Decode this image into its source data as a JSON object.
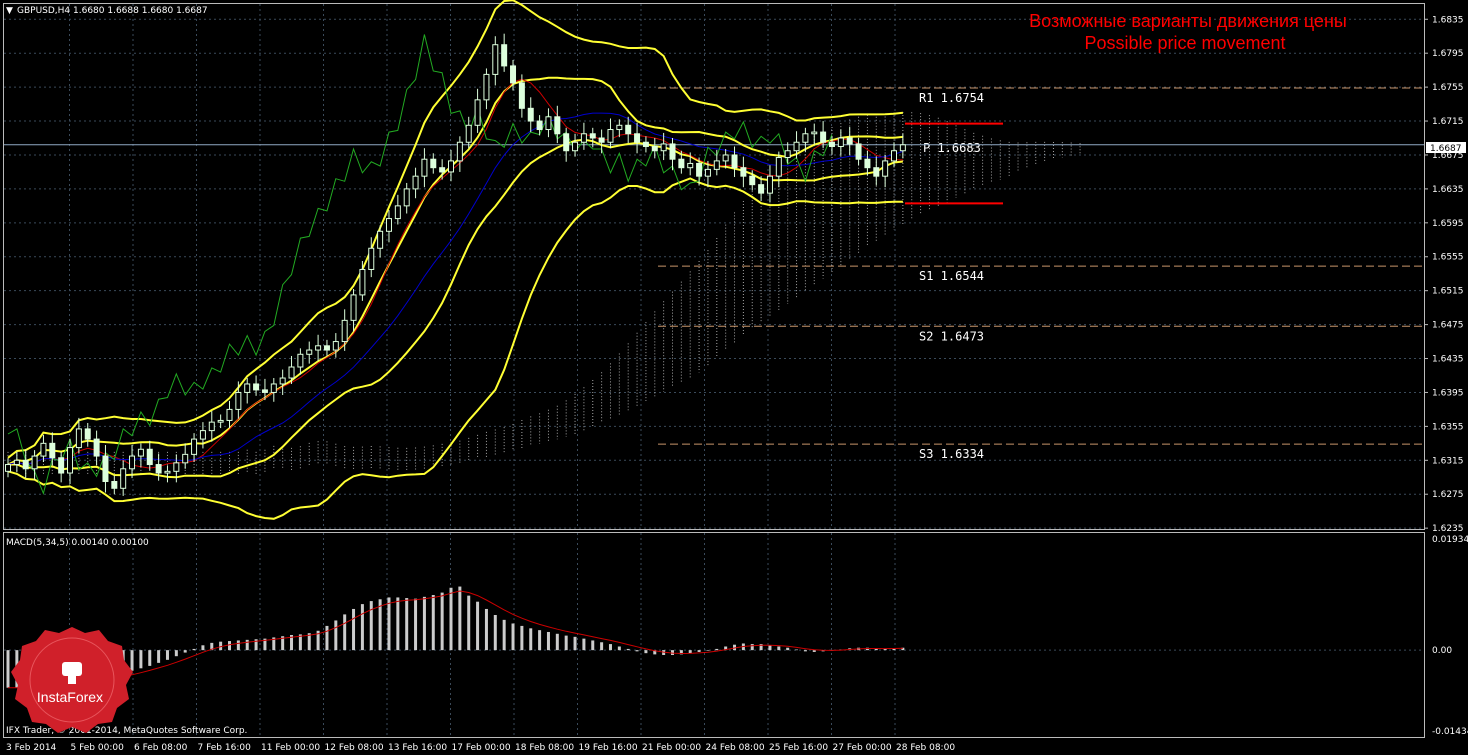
{
  "header": {
    "symbol_info": "GBPUSD,H4  1.6680 1.6688 1.6680 1.6687",
    "macd_info": "MACD(5,34,5) 0.00140 0.00100",
    "copyright": "IFX Trader, © 2001-2014, MetaQuotes Software Corp."
  },
  "annotation": {
    "line_ru": "Возможные варианты движения цены",
    "line_en": "Possible price movement"
  },
  "logo": {
    "text": "InstaForex"
  },
  "current_price": "1.6687",
  "colors": {
    "grid": "#3a4a5a",
    "price_line": "#8fa9c4",
    "bollinger": "#ffff33",
    "fast_ma": "#cc0000",
    "slow_ma": "#0000cc",
    "chikou": "#22aa22",
    "candle": "#ddffdd",
    "macd_hist": "#cccccc",
    "macd_signal": "#cc0000",
    "pivot_line": "#ff0000",
    "level_dash": "#c8956a",
    "cloud_a": "#d08a5a",
    "cloud_b": "#dddddd",
    "title_red": "#ff0000"
  },
  "chart_data": {
    "type": "candlestick",
    "price_range": [
      1.6234,
      1.6853
    ],
    "macd_range": [
      -0.01434,
      0.01934
    ],
    "price_ticks": [
      "1.6835",
      "1.6795",
      "1.6755",
      "1.6715",
      "1.6675",
      "1.6635",
      "1.6595",
      "1.6555",
      "1.6515",
      "1.6475",
      "1.6435",
      "1.6395",
      "1.6355",
      "1.6315",
      "1.6275",
      "1.6235"
    ],
    "macd_ticks": [
      "0.01934",
      "0.00",
      "-0.01434"
    ],
    "time_labels": [
      "3 Feb 2014",
      "5 Feb 00:00",
      "6 Feb 08:00",
      "7 Feb 16:00",
      "11 Feb 00:00",
      "12 Feb 08:00",
      "13 Feb 16:00",
      "17 Feb 00:00",
      "18 Feb 08:00",
      "19 Feb 16:00",
      "21 Feb 00:00",
      "24 Feb 08:00",
      "25 Feb 16:00",
      "27 Feb 00:00",
      "28 Feb 08:00"
    ],
    "levels": [
      {
        "label": "R1  1.6754",
        "value": 1.6754
      },
      {
        "label": "P  1.6683",
        "value": 1.6683
      },
      {
        "label": "S1  1.6544",
        "value": 1.6544
      },
      {
        "label": "S2  1.6473",
        "value": 1.6473
      },
      {
        "label": "S3  1.6334",
        "value": 1.6334
      }
    ],
    "projection": {
      "high": 1.6712,
      "low": 1.6618
    },
    "closes": [
      1.631,
      1.6315,
      1.6305,
      1.632,
      1.6335,
      1.6318,
      1.63,
      1.633,
      1.6352,
      1.634,
      1.632,
      1.629,
      1.6282,
      1.6305,
      1.632,
      1.6328,
      1.631,
      1.63,
      1.6302,
      1.6312,
      1.6322,
      1.634,
      1.635,
      1.636,
      1.6362,
      1.6375,
      1.6395,
      1.6405,
      1.6398,
      1.6395,
      1.6405,
      1.6412,
      1.6425,
      1.644,
      1.6445,
      1.645,
      1.6445,
      1.6455,
      1.648,
      1.651,
      1.654,
      1.6565,
      1.6585,
      1.66,
      1.6615,
      1.6635,
      1.665,
      1.667,
      1.666,
      1.6655,
      1.6668,
      1.669,
      1.671,
      1.674,
      1.677,
      1.6805,
      1.678,
      1.676,
      1.673,
      1.6715,
      1.6705,
      1.672,
      1.67,
      1.668,
      1.669,
      1.67,
      1.6695,
      1.669,
      1.6705,
      1.671,
      1.67,
      1.669,
      1.6685,
      1.668,
      1.6688,
      1.667,
      1.666,
      1.6665,
      1.665,
      1.6658,
      1.6668,
      1.6675,
      1.666,
      1.665,
      1.664,
      1.663,
      1.665,
      1.6672,
      1.668,
      1.669,
      1.67,
      1.6702,
      1.669,
      1.6685,
      1.6695,
      1.6688,
      1.667,
      1.666,
      1.665,
      1.6668,
      1.668,
      1.6687
    ],
    "macd_hist": [
      -0.0062,
      -0.0062,
      -0.0061,
      -0.006,
      -0.0059,
      -0.0058,
      -0.0056,
      -0.0055,
      -0.0053,
      -0.005,
      -0.0048,
      -0.0045,
      -0.0042,
      -0.0038,
      -0.0034,
      -0.003,
      -0.0026,
      -0.0021,
      -0.0016,
      -0.001,
      -0.0004,
      0.0002,
      0.0008,
      0.0012,
      0.0014,
      0.0015,
      0.0016,
      0.0017,
      0.0018,
      0.0019,
      0.0021,
      0.0023,
      0.0025,
      0.0026,
      0.0028,
      0.0032,
      0.004,
      0.0049,
      0.0059,
      0.0068,
      0.0076,
      0.0081,
      0.0084,
      0.0087,
      0.0087,
      0.0086,
      0.0085,
      0.0088,
      0.0091,
      0.0095,
      0.0103,
      0.0105,
      0.009,
      0.008,
      0.0068,
      0.0058,
      0.005,
      0.0044,
      0.004,
      0.0036,
      0.0033,
      0.003,
      0.0027,
      0.0024,
      0.0022,
      0.0019,
      0.0016,
      0.0013,
      0.001,
      0.0006,
      0.0002,
      -0.0002,
      -0.0005,
      -0.0007,
      -0.0008,
      -0.0008,
      -0.0007,
      -0.0005,
      -0.0003,
      -0.0001,
      0.0002,
      0.0006,
      0.0009,
      0.0011,
      0.001,
      0.001,
      0.0008,
      0.0006,
      0.0004,
      0.0001,
      -0.0002,
      -0.0003,
      -0.0002,
      -0.0001,
      0.0001,
      0.0003,
      0.0004,
      0.0004,
      0.0003,
      0.0002,
      0.0003,
      0.0004
    ]
  }
}
